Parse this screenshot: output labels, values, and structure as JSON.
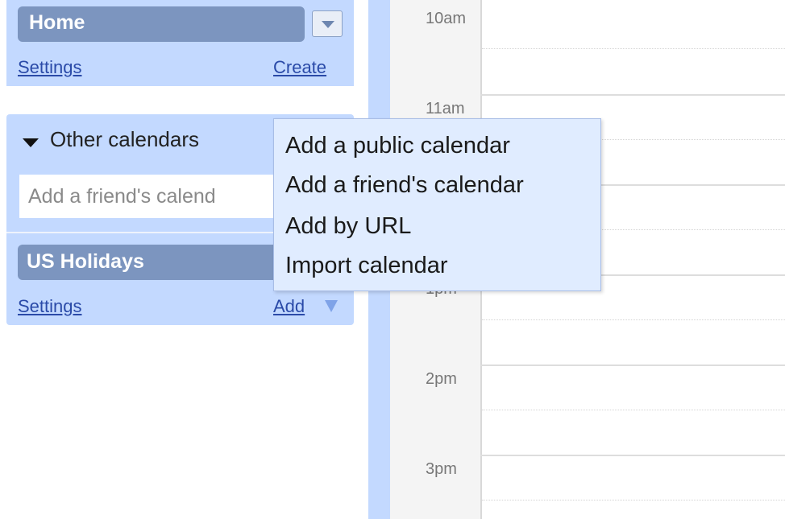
{
  "my_calendars": {
    "items": [
      {
        "label": "Home"
      }
    ],
    "settings_link": "Settings",
    "create_link": "Create"
  },
  "other_calendars": {
    "header": "Other calendars",
    "friend_input_placeholder": "Add a friend's calend",
    "items": [
      {
        "label": "US Holidays"
      }
    ],
    "settings_link": "Settings",
    "add_link": "Add"
  },
  "add_menu": {
    "items": [
      {
        "label": "Add a public calendar"
      },
      {
        "label": "Add a friend's calendar"
      },
      {
        "label": "Add by URL"
      },
      {
        "label": "Import calendar"
      }
    ]
  },
  "time_grid": {
    "hours": [
      "10am",
      "11am",
      "1pm",
      "2pm",
      "3pm"
    ]
  }
}
